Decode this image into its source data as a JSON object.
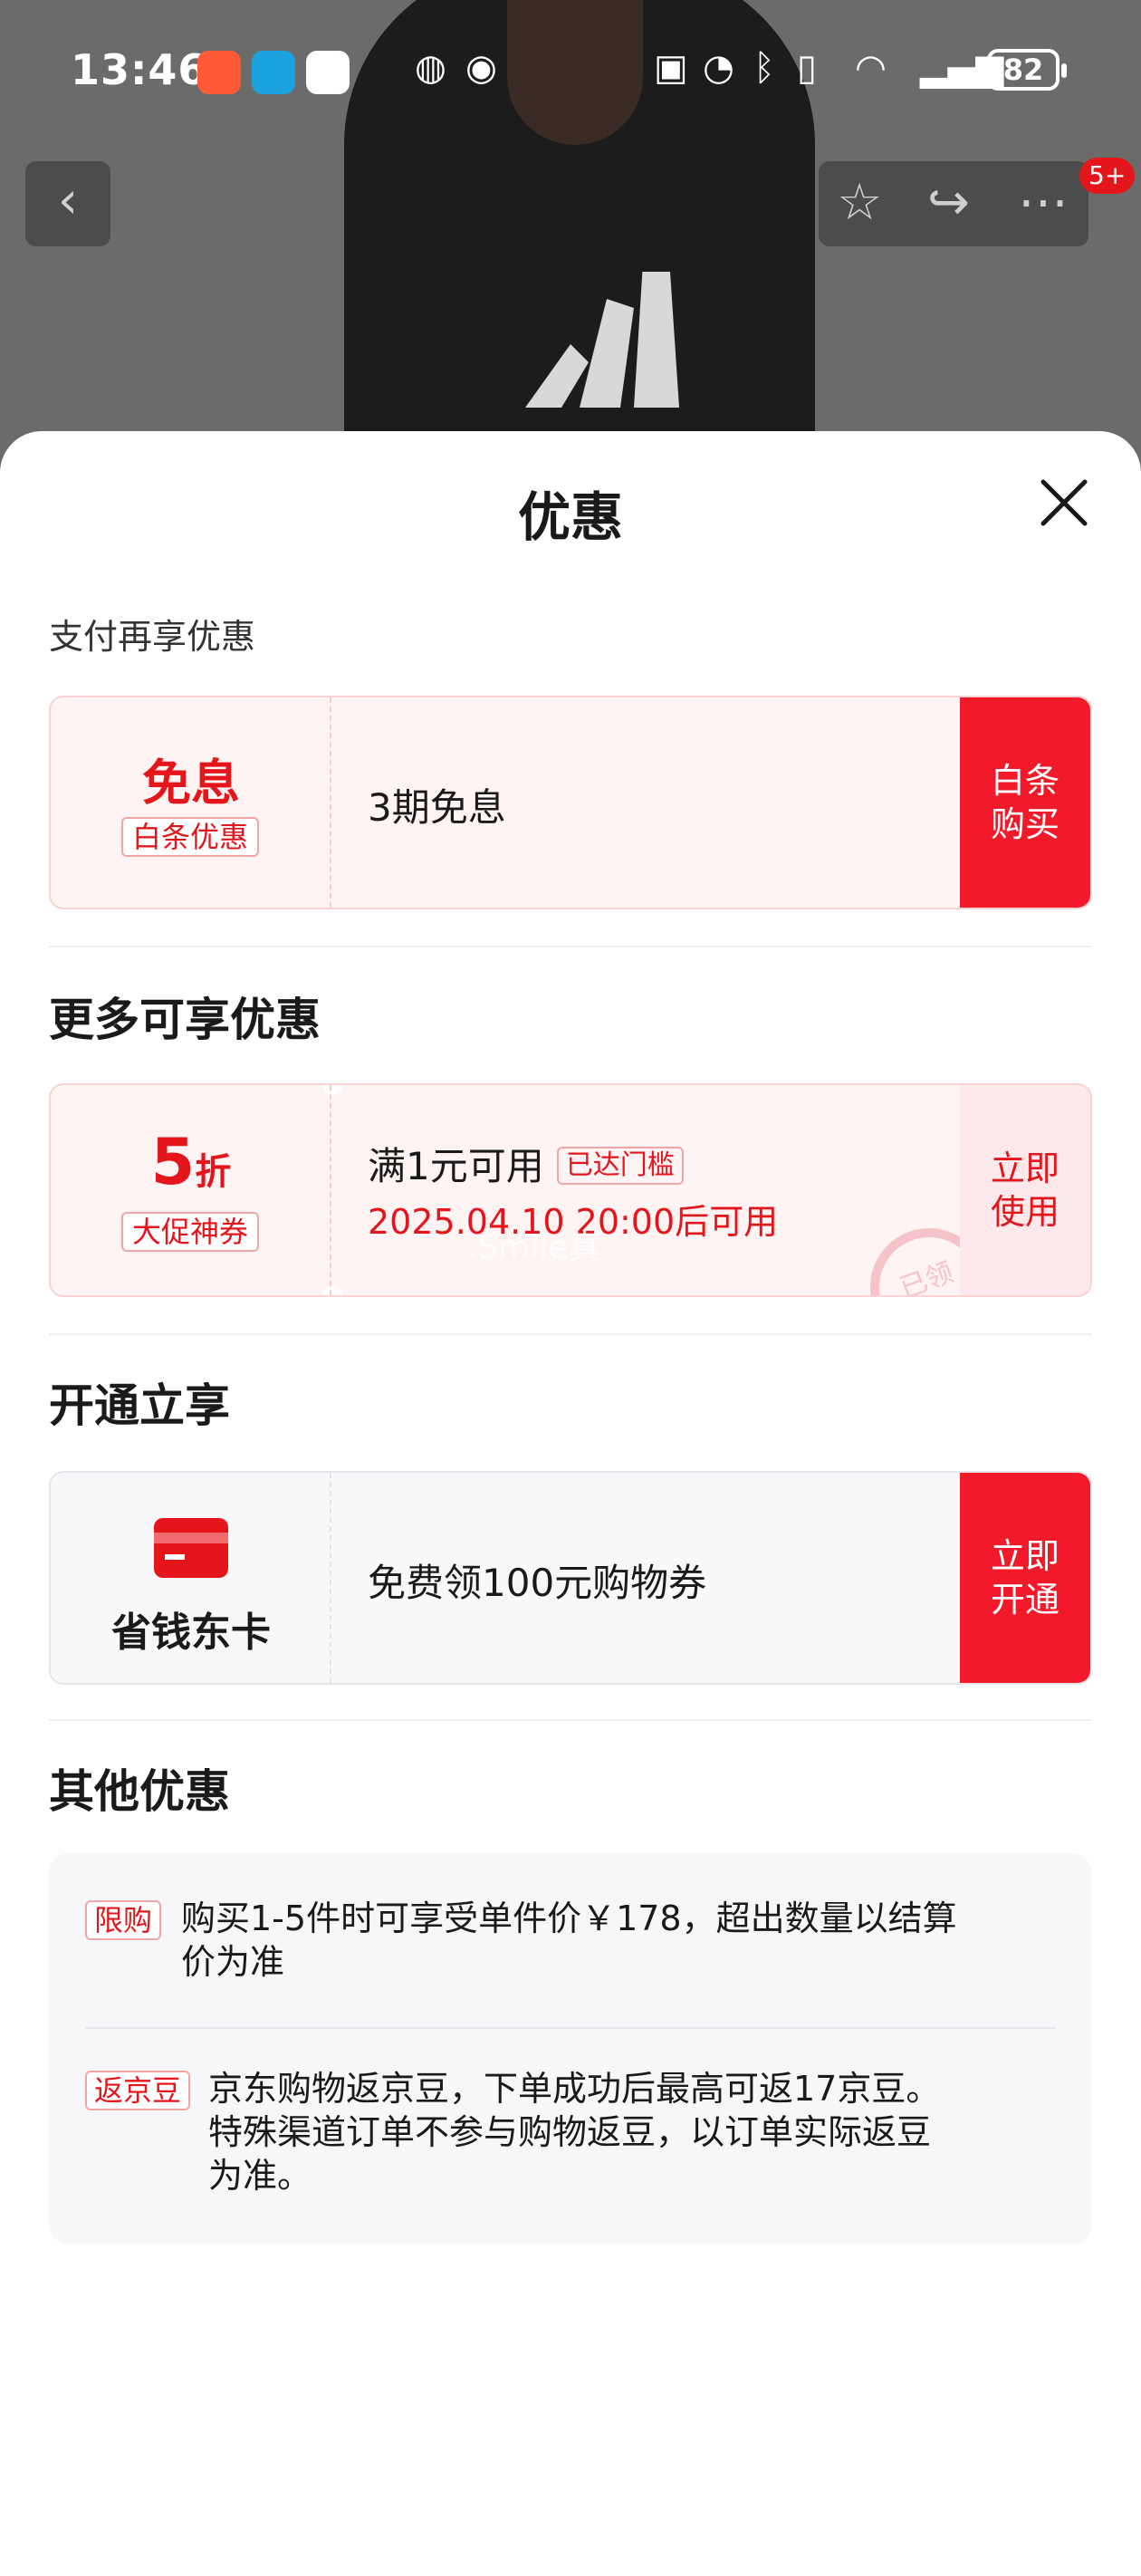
{
  "status_bar": {
    "time": "13:46",
    "battery": "82",
    "icons": [
      "app-icon-1",
      "app-icon-2",
      "qq-icon",
      "hd-icon",
      "eye-icon",
      "nfc-icon",
      "alarm-icon",
      "bluetooth-icon",
      "vibrate-icon",
      "wifi-icon",
      "signal-icon",
      "battery-icon"
    ]
  },
  "hero": {
    "badge_count": "5+"
  },
  "sheet": {
    "title": "优惠",
    "pay_section": {
      "label": "支付再享优惠",
      "card": {
        "left_big": "免息",
        "left_tag": "白条优惠",
        "main_text": "3期免息",
        "button_line1": "白条",
        "button_line2": "购买"
      }
    },
    "more_section": {
      "label": "更多可享优惠",
      "card": {
        "discount_number": "5",
        "discount_unit": "折",
        "left_tag": "大促神券",
        "main_text": "满1元可用",
        "main_tag": "已达门槛",
        "time_text": "2025.04.10 20:00后可用",
        "watermark": ".Smile真",
        "stamp": "已领",
        "button_line1": "立即",
        "button_line2": "使用"
      }
    },
    "open_section": {
      "label": "开通立享",
      "card": {
        "card_name": "省钱东卡",
        "main_text": "免费领100元购物券",
        "button_line1": "立即",
        "button_line2": "开通"
      }
    },
    "other_section": {
      "label": "其他优惠",
      "items": [
        {
          "tag": "限购",
          "line1": "购买1-5件时可享受单件价￥178，超出数量以结算",
          "line2": "价为准"
        },
        {
          "tag": "返京豆",
          "line1": "京东购物返京豆，下单成功后最高可返17京豆。",
          "line2": "特殊渠道订单不参与购物返豆，以订单实际返豆",
          "line3": "为准。"
        }
      ]
    }
  },
  "colors": {
    "accent_red": "#f21a2a",
    "text_red": "#e4161c",
    "pink_bg": "#fff4f4"
  }
}
